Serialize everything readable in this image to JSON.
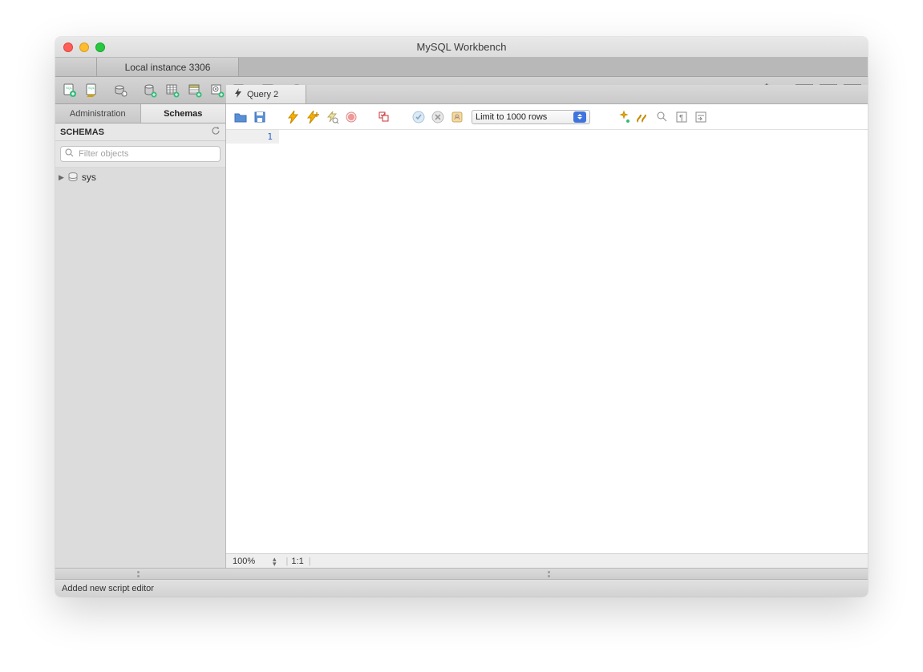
{
  "window": {
    "title": "MySQL Workbench"
  },
  "tabs": {
    "connection_label": "Local instance 3306"
  },
  "sidebar": {
    "tabs": {
      "admin": "Administration",
      "schemas": "Schemas"
    },
    "header": "SCHEMAS",
    "filter_placeholder": "Filter objects",
    "items": [
      {
        "name": "sys"
      }
    ]
  },
  "editor": {
    "tabs": [
      {
        "label": "Query 2"
      }
    ],
    "limit_label": "Limit to 1000 rows",
    "line_numbers": [
      "1"
    ],
    "status": {
      "zoom": "100%",
      "cursor": "1:1"
    }
  },
  "status_bar": {
    "message": "Added new script editor"
  },
  "toolbar_icons": {
    "new_sql": "new-sql-icon",
    "open_sql": "open-sql-icon",
    "inspect": "inspector-icon",
    "add_schema": "add-schema-icon",
    "add_table": "add-table-icon",
    "add_view": "add-view-icon",
    "add_proc": "add-procedure-icon",
    "add_func": "add-function-icon",
    "search": "search-table-icon",
    "reconnect": "reconnect-icon",
    "settings": "settings-icon"
  }
}
